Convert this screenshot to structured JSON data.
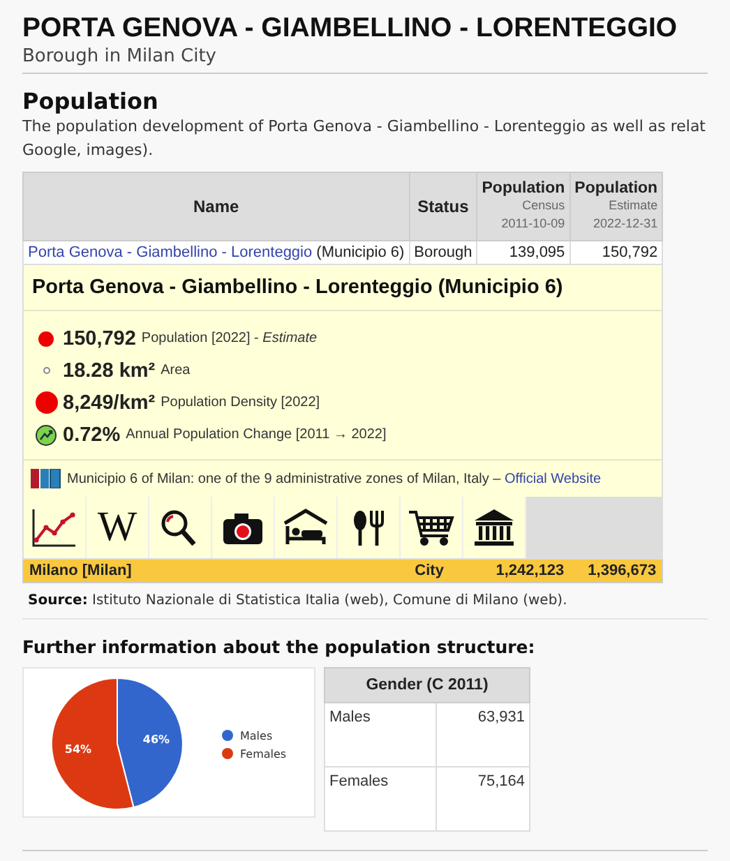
{
  "header": {
    "title": "PORTA GENOVA - GIAMBELLINO - LORENTEGGIO",
    "subtitle": "Borough in Milan City"
  },
  "population": {
    "heading": "Population",
    "intro": "The population development of Porta Genova - Giambellino - Lorenteggio as well as relat",
    "intro_line2": "Google, images).",
    "table": {
      "columns": [
        {
          "label": "Name"
        },
        {
          "label": "Status"
        },
        {
          "label": "Population",
          "sub": [
            "Census",
            "2011-10-09"
          ]
        },
        {
          "label": "Population",
          "sub": [
            "Estimate",
            "2022-12-31"
          ]
        }
      ],
      "row": {
        "name_link": "Porta Genova - Giambellino - Lorenteggio",
        "name_suffix": " (Municipio 6)",
        "status": "Borough",
        "census": "139,095",
        "estimate": "150,792"
      },
      "detail": {
        "title": "Porta Genova - Giambellino - Lorenteggio (Municipio 6)",
        "stats": [
          {
            "kind": "population",
            "value": "150,792",
            "label": "Population [2022] - *Estimate*"
          },
          {
            "kind": "area",
            "value": "18.28 km²",
            "label": "Area"
          },
          {
            "kind": "density",
            "value": "8,249/km²",
            "label": "Population Density [2022]"
          },
          {
            "kind": "change",
            "value": "0.72%",
            "label": "Annual Population Change [2011 → 2022]"
          }
        ],
        "description": "Municipio 6 of Milan: one of the 9 administrative zones of Milan, Italy – ",
        "website_link": "Official Website",
        "links": [
          {
            "kind": "chart"
          },
          {
            "kind": "wiki",
            "glyph": "W"
          },
          {
            "kind": "search"
          },
          {
            "kind": "camera"
          },
          {
            "kind": "hotel"
          },
          {
            "kind": "food"
          },
          {
            "kind": "cart"
          },
          {
            "kind": "museum"
          }
        ]
      },
      "parent_row": {
        "name": "Milano [Milan]",
        "status": "City",
        "census": "1,242,123",
        "estimate": "1,396,673"
      }
    },
    "source_label": "Source:",
    "source": "Istituto Nazionale di Statistica Italia (web), Comune di Milano (web)."
  },
  "structure": {
    "heading": "Further information about the population structure:",
    "chart_data": {
      "type": "pie",
      "categories": [
        "Males",
        "Females"
      ],
      "values": [
        46,
        54
      ],
      "colors": [
        "#3366cc",
        "#dc3912"
      ],
      "value_labels": [
        "46%",
        "54%"
      ],
      "legend": true
    },
    "gender_table": {
      "title": "Gender (C 2011)",
      "rows": [
        {
          "label": "Males",
          "value": "63,931"
        },
        {
          "label": "Females",
          "value": "75,164"
        }
      ]
    }
  }
}
